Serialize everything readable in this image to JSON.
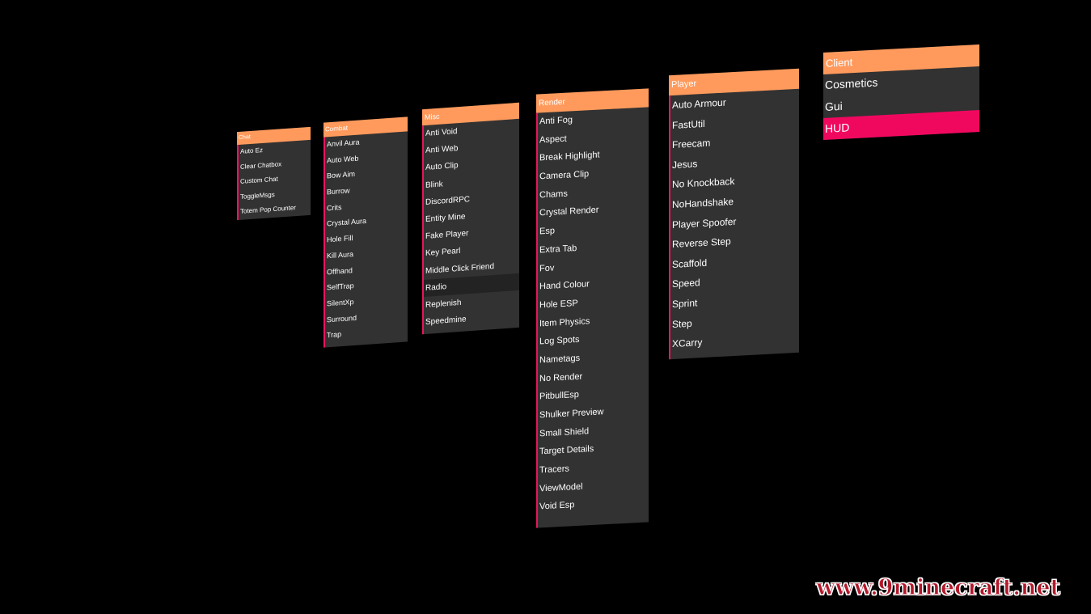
{
  "colors": {
    "background": "#000000",
    "panel_body": "#323232",
    "header_accent": "#ff9a5c",
    "item_accent": "#e8155f",
    "active_item": "#f0085f",
    "text": "#ffffff"
  },
  "panels": [
    {
      "title": "Chat",
      "items": [
        "Auto Ez",
        "Clear Chatbox",
        "Custom Chat",
        "ToggleMsgs",
        "Totem Pop Counter"
      ]
    },
    {
      "title": "Combat",
      "items": [
        "Anvil Aura",
        "Auto Web",
        "Bow Aim",
        "Burrow",
        "Crits",
        "Crystal Aura",
        "Hole Fill",
        "Kill Aura",
        "Offhand",
        "SelfTrap",
        "SilentXp",
        "Surround",
        "Trap"
      ]
    },
    {
      "title": "Misc",
      "items": [
        "Anti Void",
        "Anti Web",
        "Auto Clip",
        "Blink",
        "DiscordRPC",
        "Entity Mine",
        "Fake Player",
        "Key Pearl",
        "Middle Click Friend",
        "Radio",
        "Replenish",
        "Speedmine"
      ]
    },
    {
      "title": "Render",
      "items": [
        "Anti Fog",
        "Aspect",
        "Break Highlight",
        "Camera Clip",
        "Chams",
        "Crystal Render",
        "Esp",
        "Extra Tab",
        "Fov",
        "Hand Colour",
        "Hole ESP",
        "Item Physics",
        "Log Spots",
        "Nametags",
        "No Render",
        "PitbullEsp",
        "Shulker Preview",
        "Small Shield",
        "Target Details",
        "Tracers",
        "ViewModel",
        "Void Esp"
      ]
    },
    {
      "title": "Player",
      "items": [
        "Auto Armour",
        "FastUtil",
        "Freecam",
        "Jesus",
        "No Knockback",
        "NoHandshake",
        "Player Spoofer",
        "Reverse Step",
        "Scaffold",
        "Speed",
        "Sprint",
        "Step",
        "XCarry"
      ]
    },
    {
      "title": "Client",
      "items": [
        "Cosmetics",
        "Gui",
        "HUD"
      ]
    }
  ],
  "hovered_item": "Radio",
  "active_item": "HUD",
  "watermark": "www.9minecraft.net"
}
